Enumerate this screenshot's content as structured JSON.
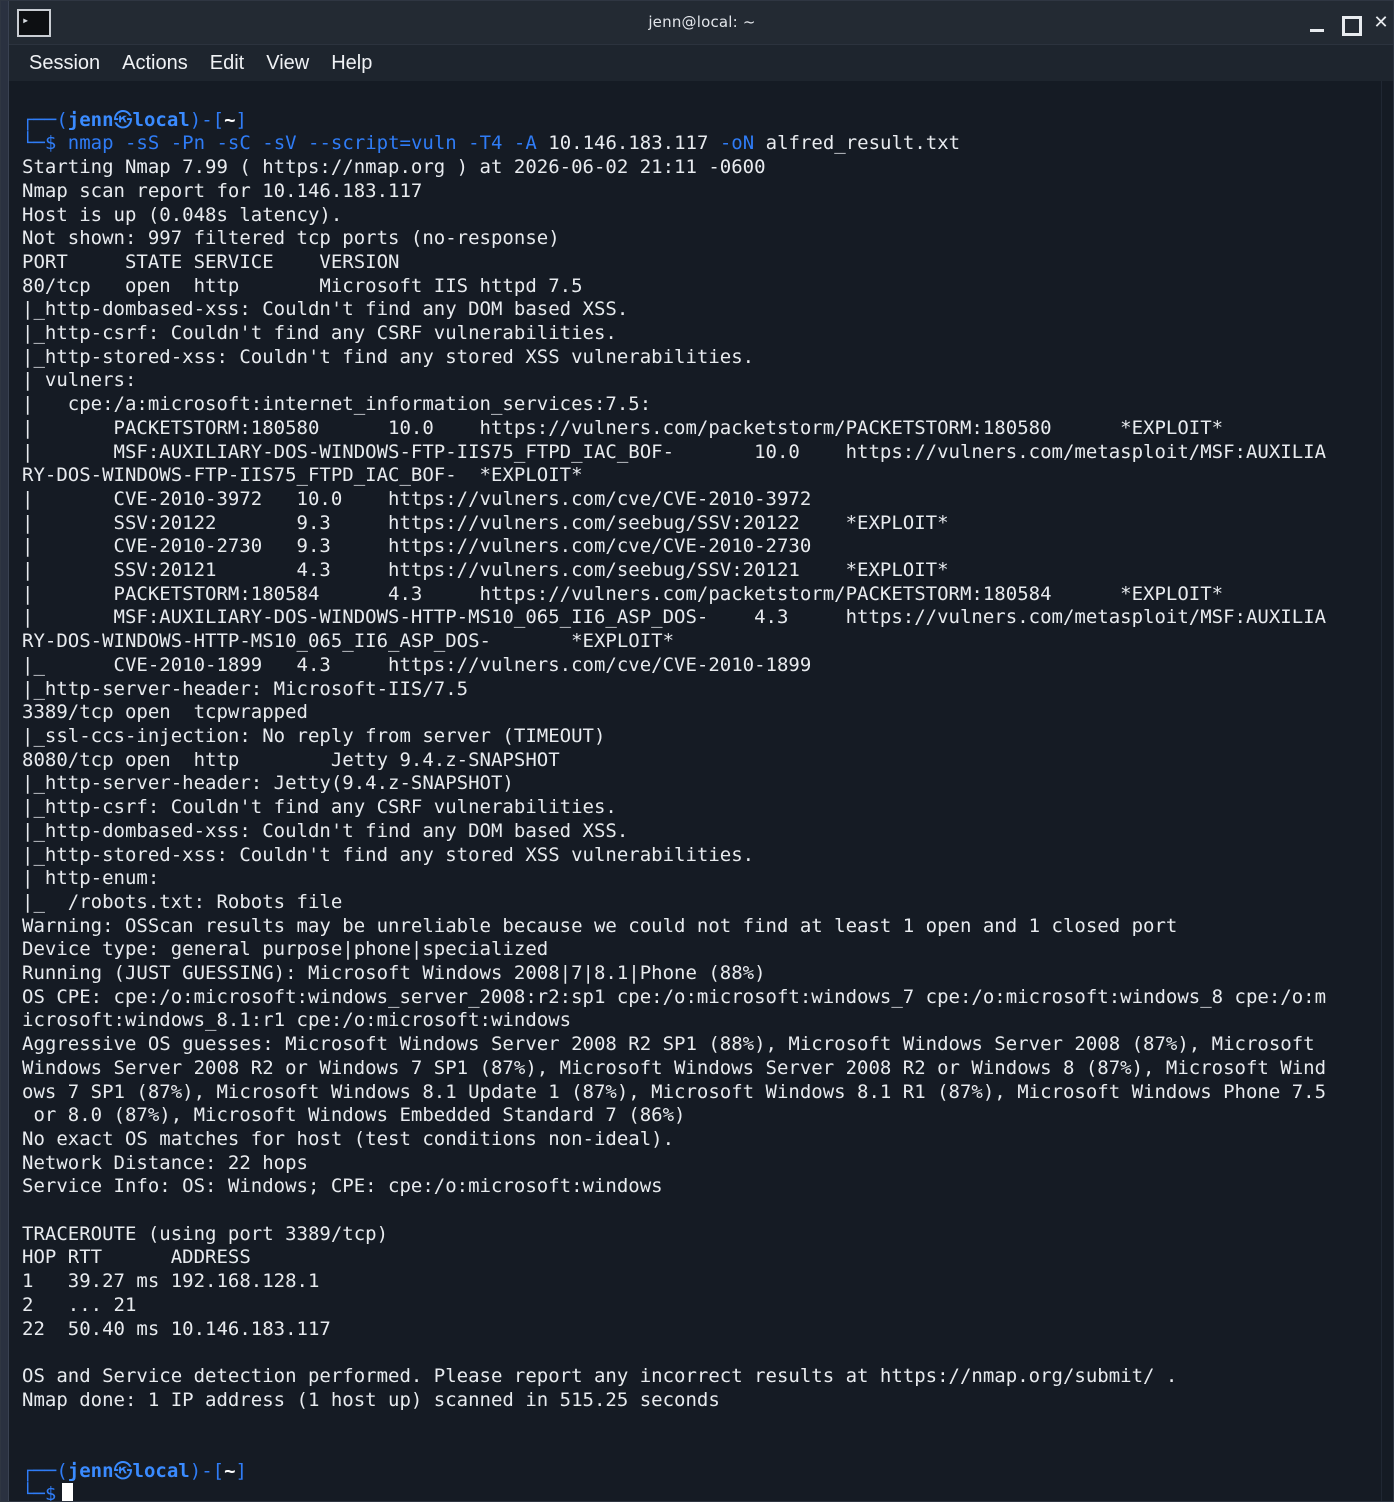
{
  "window": {
    "title": "jenn@local: ~",
    "menu": [
      "Session",
      "Actions",
      "Edit",
      "View",
      "Help"
    ]
  },
  "terminal": {
    "prompt_user": "jenn",
    "prompt_host": "local",
    "prompt_dir": "~",
    "command_prefix": "nmap",
    "command_flags": "-sS -Pn -sC -sV --script=vuln -T4 -A",
    "command_target": "10.146.183.117",
    "command_out_flag": "-oN",
    "command_out_file": "alfred_result.txt",
    "lines": [
      "Starting Nmap 7.99 ( https://nmap.org ) at 2026-06-02 21:11 -0600",
      "Nmap scan report for 10.146.183.117",
      "Host is up (0.048s latency).",
      "Not shown: 997 filtered tcp ports (no-response)",
      "PORT     STATE SERVICE    VERSION",
      "80/tcp   open  http       Microsoft IIS httpd 7.5",
      "|_http-dombased-xss: Couldn't find any DOM based XSS.",
      "|_http-csrf: Couldn't find any CSRF vulnerabilities.",
      "|_http-stored-xss: Couldn't find any stored XSS vulnerabilities.",
      "| vulners:",
      "|   cpe:/a:microsoft:internet_information_services:7.5:",
      "|       PACKETSTORM:180580      10.0    https://vulners.com/packetstorm/PACKETSTORM:180580      *EXPLOIT*",
      "|       MSF:AUXILIARY-DOS-WINDOWS-FTP-IIS75_FTPD_IAC_BOF-       10.0    https://vulners.com/metasploit/MSF:AUXILIA",
      "RY-DOS-WINDOWS-FTP-IIS75_FTPD_IAC_BOF-  *EXPLOIT*",
      "|       CVE-2010-3972   10.0    https://vulners.com/cve/CVE-2010-3972",
      "|       SSV:20122       9.3     https://vulners.com/seebug/SSV:20122    *EXPLOIT*",
      "|       CVE-2010-2730   9.3     https://vulners.com/cve/CVE-2010-2730",
      "|       SSV:20121       4.3     https://vulners.com/seebug/SSV:20121    *EXPLOIT*",
      "|       PACKETSTORM:180584      4.3     https://vulners.com/packetstorm/PACKETSTORM:180584      *EXPLOIT*",
      "|       MSF:AUXILIARY-DOS-WINDOWS-HTTP-MS10_065_II6_ASP_DOS-    4.3     https://vulners.com/metasploit/MSF:AUXILIA",
      "RY-DOS-WINDOWS-HTTP-MS10_065_II6_ASP_DOS-       *EXPLOIT*",
      "|_      CVE-2010-1899   4.3     https://vulners.com/cve/CVE-2010-1899",
      "|_http-server-header: Microsoft-IIS/7.5",
      "3389/tcp open  tcpwrapped",
      "|_ssl-ccs-injection: No reply from server (TIMEOUT)",
      "8080/tcp open  http        Jetty 9.4.z-SNAPSHOT",
      "|_http-server-header: Jetty(9.4.z-SNAPSHOT)",
      "|_http-csrf: Couldn't find any CSRF vulnerabilities.",
      "|_http-dombased-xss: Couldn't find any DOM based XSS.",
      "|_http-stored-xss: Couldn't find any stored XSS vulnerabilities.",
      "| http-enum:",
      "|_  /robots.txt: Robots file",
      "Warning: OSScan results may be unreliable because we could not find at least 1 open and 1 closed port",
      "Device type: general purpose|phone|specialized",
      "Running (JUST GUESSING): Microsoft Windows 2008|7|8.1|Phone (88%)",
      "OS CPE: cpe:/o:microsoft:windows_server_2008:r2:sp1 cpe:/o:microsoft:windows_7 cpe:/o:microsoft:windows_8 cpe:/o:m",
      "icrosoft:windows_8.1:r1 cpe:/o:microsoft:windows",
      "Aggressive OS guesses: Microsoft Windows Server 2008 R2 SP1 (88%), Microsoft Windows Server 2008 (87%), Microsoft",
      "Windows Server 2008 R2 or Windows 7 SP1 (87%), Microsoft Windows Server 2008 R2 or Windows 8 (87%), Microsoft Wind",
      "ows 7 SP1 (87%), Microsoft Windows 8.1 Update 1 (87%), Microsoft Windows 8.1 R1 (87%), Microsoft Windows Phone 7.5",
      " or 8.0 (87%), Microsoft Windows Embedded Standard 7 (86%)",
      "No exact OS matches for host (test conditions non-ideal).",
      "Network Distance: 22 hops",
      "Service Info: OS: Windows; CPE: cpe:/o:microsoft:windows",
      "",
      "TRACEROUTE (using port 3389/tcp)",
      "HOP RTT      ADDRESS",
      "1   39.27 ms 192.168.128.1",
      "2   ... 21",
      "22  50.40 ms 10.146.183.117",
      "",
      "OS and Service detection performed. Please report any incorrect results at https://nmap.org/submit/ .",
      "Nmap done: 1 IP address (1 host up) scanned in 515.25 seconds",
      ""
    ]
  }
}
